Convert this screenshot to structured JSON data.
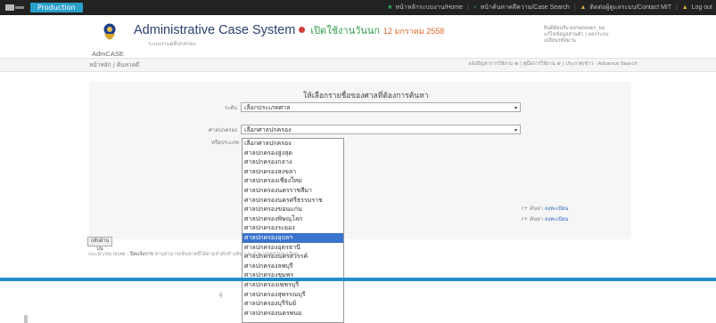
{
  "topbar": {
    "badge": "Production",
    "links": [
      {
        "icon": "home-icon",
        "label": "หน้าหลักระบบงาน/Home"
      },
      {
        "icon": "search-icon",
        "label": "หน้าค้นหาคดีความ/Case Search"
      },
      {
        "icon": "contact-icon",
        "label": "ติดต่อผู้ดูแลระบบ/Contact MIT"
      },
      {
        "icon": "logout-icon",
        "label": "Log out"
      }
    ]
  },
  "header": {
    "title": "Administrative Case System",
    "open_label": "เปิดใช้งานวันนก",
    "date": "12 มกราคม 2558",
    "subtitle": "ระบบงานคดีปกครอง",
    "app_code": "AdmCASE",
    "user_lines": [
      "ยินดีต้อนรับ ผลรอดลงดก_ยอ",
      "แก้ไขข้อมูลส่วนตัว | ออกระบบ",
      "เปลี่ยนรหัสผ่าน"
    ]
  },
  "breadcrumb": {
    "left": "หน้าหลัก / ค้นหาคดี",
    "right": "แจ้งปัญหาการใช้งาน ⊕ | คู่มือการใช้งาน ⊕ | ประกาศ/ข่าว · Advance Search"
  },
  "form": {
    "title": "ให้เลือกรายชื่อของศาลที่ต้องการค้นหา",
    "field1_label": "ระดับ",
    "field1_value": "เลือกประเภทศาล",
    "field2_label": "ศาลปกครอง",
    "field2_value": "เลือกศาลปกครอง",
    "field3_label": "หรือประเภท"
  },
  "dropdown": {
    "options": [
      "เลือกศาลปกครอง",
      "ศาลปกครองสูงสุด",
      "ศาลปกครองกลาง",
      "ศาลปกครองสงขลา",
      "ศาลปกครองเชียงใหม่",
      "ศาลปกครองนครราชสีมา",
      "ศาลปกครองนครศรีธรรมราช",
      "ศาลปกครองขอนแก่น",
      "ศาลปกครองพิษณุโลก",
      "ศาลปกครองระยอง",
      "ศาลปกครองอุบลฯ",
      "ศาลปกครองอุดรธานี",
      "ศาลปกครองนครสวรรค์",
      "ศาลปกครองลพบุรี",
      "ศาลปกครองชุมพร",
      "ศาลปกครองเพชรบุรี",
      "ศาลปกครองสุพรรณบุรี",
      "ศาลปกครองบุรีรัมย์",
      "ศาลปกครองนครพนม"
    ],
    "selected_index": 10
  },
  "side_notes": [
    {
      "text": "r+ ค้นหา",
      "link": "ลงทะเบียน"
    },
    {
      "text": "r+ ค้นหา",
      "link": "ลงทะเบียน"
    }
  ],
  "top_button": "กลับด้านบน",
  "hint": {
    "prefix": "แนะนำ/หมายเหตุ :",
    "bold": "ปิดแจ้งการ",
    "rest": "ท่านสามารถค้นหาคดีได้ตามลำดับข้างต้น และสามารถดูรายละเอียด"
  },
  "footer_label": "ผู้ ",
  "colors": {
    "accent": "#2a9fc9",
    "blueline": "#1f8ecb",
    "selected": "#3a74cc",
    "title": "#2a3f6e"
  }
}
